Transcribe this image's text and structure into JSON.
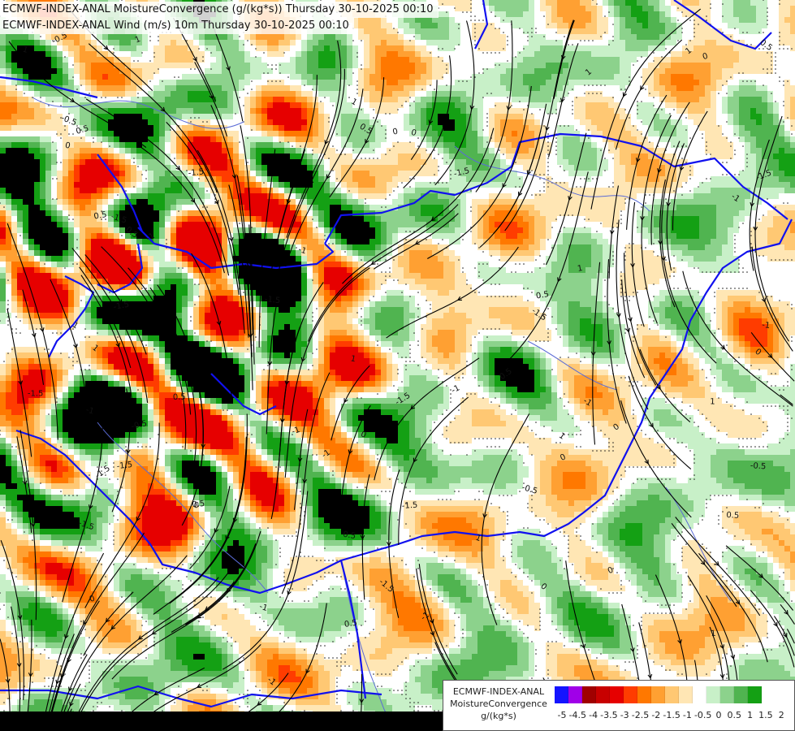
{
  "header": {
    "line1": "ECMWF-INDEX-ANAL MoistureConvergence (g/(kg*s)) Thursday 30-10-2025 00:10",
    "line2": "ECMWF-INDEX-ANAL Wind (m/s) 10m Thursday 30-10-2025 00:10"
  },
  "map": {
    "contour_labels": [
      "-0.5",
      "0",
      "0.5",
      "-1",
      "1",
      "-1.5"
    ],
    "colors": {
      "country_border": "#1111ee",
      "river": "#5a6bd6",
      "streamline": "#000000",
      "dotted_contour": "#000000"
    }
  },
  "legend": {
    "line1": "ECMWF-INDEX-ANAL",
    "line2": "MoistureConvergence",
    "line3": "g/(kg*s)",
    "ticks": [
      "-5",
      "-4.5",
      "-4",
      "-3.5",
      "-3",
      "-2.5",
      "-2",
      "-1.5",
      "-1",
      "-0.5",
      "0",
      "0.5",
      "1",
      "1.5",
      "2"
    ],
    "colors": [
      "#1414ff",
      "#a000e8",
      "#a00000",
      "#c80000",
      "#e60000",
      "#ff3c00",
      "#ff7800",
      "#ffa032",
      "#ffc873",
      "#ffe6b4",
      "#ffffff",
      "#c8f0c8",
      "#8cd28c",
      "#50b450",
      "#14a014"
    ]
  }
}
